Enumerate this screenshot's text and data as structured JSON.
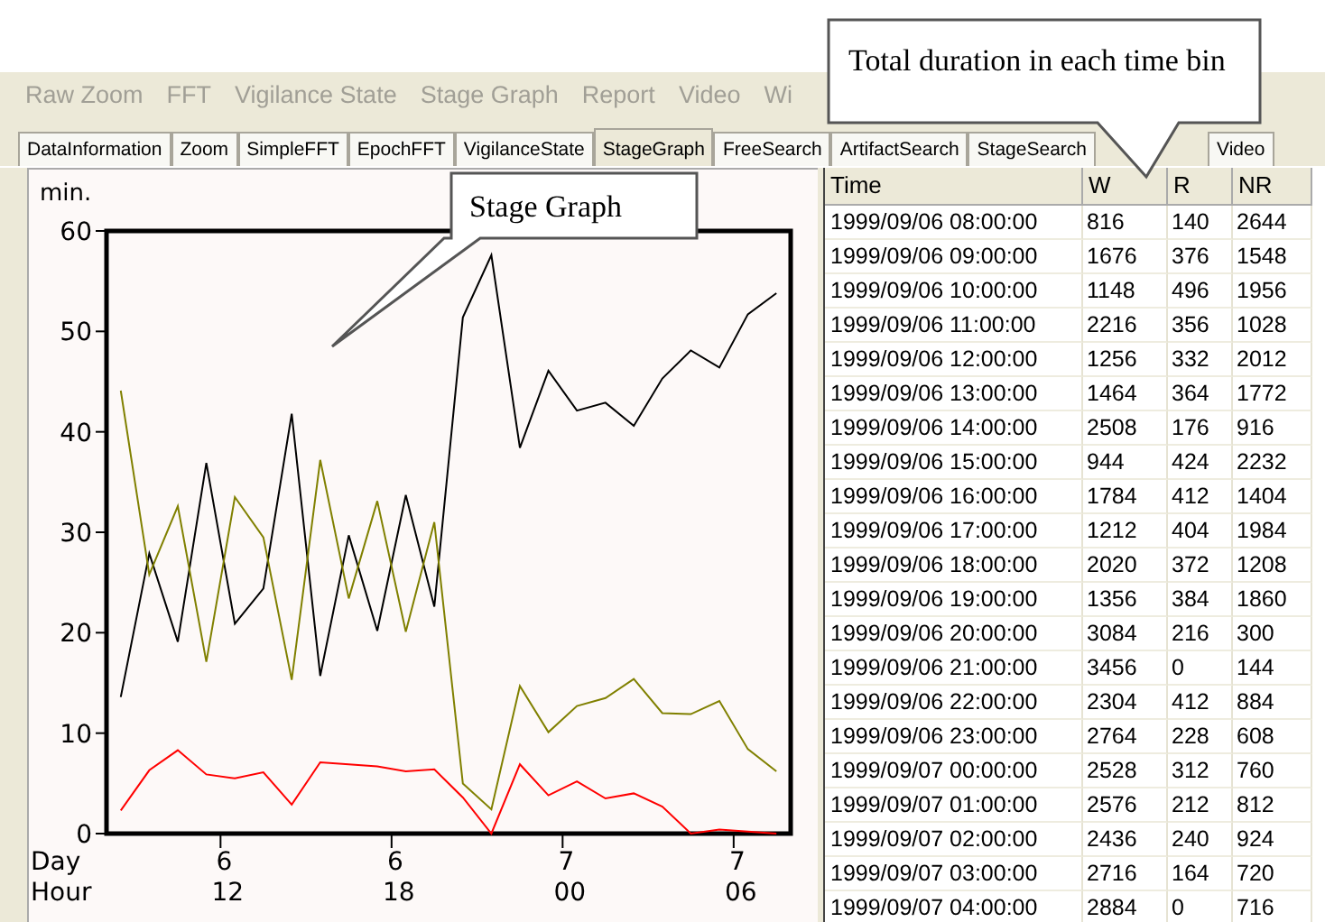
{
  "menu_bar": {
    "items": [
      "Raw Zoom",
      "FFT",
      "Vigilance State",
      "Stage Graph",
      "Report",
      "Video",
      "Wi"
    ]
  },
  "tabs": [
    {
      "label": "DataInformation",
      "selected": false
    },
    {
      "label": "Zoom",
      "selected": false
    },
    {
      "label": "SimpleFFT",
      "selected": false
    },
    {
      "label": "EpochFFT",
      "selected": false
    },
    {
      "label": "VigilanceState",
      "selected": false
    },
    {
      "label": "StageGraph",
      "selected": true
    },
    {
      "label": "FreeSearch",
      "selected": false
    },
    {
      "label": "ArtifactSearch",
      "selected": false
    },
    {
      "label": "StageSearch",
      "selected": false
    },
    {
      "label": "Video",
      "selected": false
    }
  ],
  "stage_graph": {
    "callout": "Stage Graph",
    "row_labels": [
      "Day",
      "Hour"
    ],
    "time_ticks": [
      {
        "day": "6",
        "hour": "12"
      },
      {
        "day": "6",
        "hour": "18"
      },
      {
        "day": "7",
        "hour": "00"
      },
      {
        "day": "7",
        "hour": "06"
      }
    ],
    "chart_data": {
      "type": "line",
      "ylabel": "min.",
      "ylim": [
        0,
        60
      ],
      "yticks": [
        0,
        10,
        20,
        30,
        40,
        50,
        60
      ],
      "series": [
        {
          "color": "#000000",
          "values": [
            13.6,
            27.9,
            19.1,
            36.9,
            20.9,
            24.4,
            41.8,
            15.7,
            29.7,
            20.2,
            33.7,
            22.6,
            51.4,
            57.6,
            38.4,
            46.1,
            42.1,
            42.9,
            40.6,
            45.3,
            48.1,
            46.4,
            51.7,
            53.8
          ]
        },
        {
          "color": "#ff0000",
          "values": [
            2.3,
            6.3,
            8.3,
            5.9,
            5.5,
            6.1,
            2.9,
            7.1,
            6.9,
            6.7,
            6.2,
            6.4,
            3.6,
            0,
            6.9,
            3.8,
            5.2,
            3.5,
            4,
            2.7,
            0,
            0.4,
            0.2,
            0
          ]
        },
        {
          "color": "#808000",
          "values": [
            44.1,
            25.8,
            32.6,
            17.1,
            33.5,
            29.5,
            15.3,
            37.2,
            23.4,
            33.1,
            20.1,
            31,
            5,
            2.4,
            14.7,
            10.1,
            12.7,
            13.5,
            15.4,
            12,
            11.9,
            13.2,
            8.4,
            6.2
          ]
        }
      ]
    }
  },
  "table": {
    "callout": "Total duration in each time bin",
    "columns": [
      "Time",
      "W",
      "R",
      "NR"
    ],
    "rows": [
      [
        "1999/09/06 08:00:00",
        "816",
        "140",
        "2644"
      ],
      [
        "1999/09/06 09:00:00",
        "1676",
        "376",
        "1548"
      ],
      [
        "1999/09/06 10:00:00",
        "1148",
        "496",
        "1956"
      ],
      [
        "1999/09/06 11:00:00",
        "2216",
        "356",
        "1028"
      ],
      [
        "1999/09/06 12:00:00",
        "1256",
        "332",
        "2012"
      ],
      [
        "1999/09/06 13:00:00",
        "1464",
        "364",
        "1772"
      ],
      [
        "1999/09/06 14:00:00",
        "2508",
        "176",
        "916"
      ],
      [
        "1999/09/06 15:00:00",
        "944",
        "424",
        "2232"
      ],
      [
        "1999/09/06 16:00:00",
        "1784",
        "412",
        "1404"
      ],
      [
        "1999/09/06 17:00:00",
        "1212",
        "404",
        "1984"
      ],
      [
        "1999/09/06 18:00:00",
        "2020",
        "372",
        "1208"
      ],
      [
        "1999/09/06 19:00:00",
        "1356",
        "384",
        "1860"
      ],
      [
        "1999/09/06 20:00:00",
        "3084",
        "216",
        "300"
      ],
      [
        "1999/09/06 21:00:00",
        "3456",
        "0",
        "144"
      ],
      [
        "1999/09/06 22:00:00",
        "2304",
        "412",
        "884"
      ],
      [
        "1999/09/06 23:00:00",
        "2764",
        "228",
        "608"
      ],
      [
        "1999/09/07 00:00:00",
        "2528",
        "312",
        "760"
      ],
      [
        "1999/09/07 01:00:00",
        "2576",
        "212",
        "812"
      ],
      [
        "1999/09/07 02:00:00",
        "2436",
        "240",
        "924"
      ],
      [
        "1999/09/07 03:00:00",
        "2716",
        "164",
        "720"
      ],
      [
        "1999/09/07 04:00:00",
        "2884",
        "0",
        "716"
      ]
    ]
  }
}
